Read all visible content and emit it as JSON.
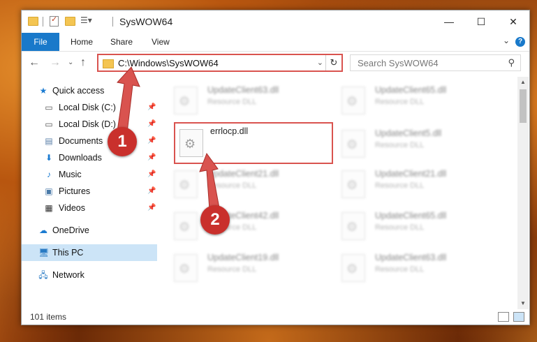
{
  "window": {
    "title": "SysWOW64"
  },
  "ribbon": {
    "tabs": {
      "file": "File",
      "home": "Home",
      "share": "Share",
      "view": "View"
    },
    "help": "?"
  },
  "nav": {
    "address": "C:\\Windows\\SysWOW64",
    "search_placeholder": "Search SysWOW64"
  },
  "sidebar": {
    "quick_access": "Quick access",
    "local_c": "Local Disk (C:)",
    "local_d": "Local Disk (D:)",
    "documents": "Documents",
    "downloads": "Downloads",
    "music": "Music",
    "pictures": "Pictures",
    "videos": "Videos",
    "onedrive": "OneDrive",
    "this_pc": "This PC",
    "network": "Network"
  },
  "files": {
    "r0c0": {
      "name": "UpdateClient63.dll",
      "type": "Resource DLL"
    },
    "r0c1": {
      "name": "UpdateClient65.dll",
      "type": "Resource DLL"
    },
    "r1c0": {
      "name": "errlocp.dll",
      "type": ""
    },
    "r1c1": {
      "name": "UpdateClient5.dll",
      "type": "Resource DLL"
    },
    "r2c0": {
      "name": "UpdateClient21.dll",
      "type": "Resource DLL"
    },
    "r2c1": {
      "name": "UpdateClient21.dll",
      "type": "Resource DLL"
    },
    "r3c0": {
      "name": "UpdateClient42.dll",
      "type": "Resource DLL"
    },
    "r3c1": {
      "name": "UpdateClient65.dll",
      "type": "Resource DLL"
    },
    "r4c0": {
      "name": "UpdateClient19.dll",
      "type": "Resource DLL"
    },
    "r4c1": {
      "name": "UpdateClient63.dll",
      "type": "Resource DLL"
    }
  },
  "status": {
    "items": "101 items"
  },
  "annotations": {
    "step1": "1",
    "step2": "2"
  }
}
